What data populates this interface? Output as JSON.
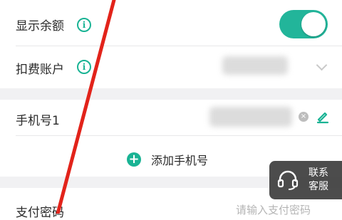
{
  "rows": {
    "show_balance": {
      "label": "显示余额",
      "toggle_on": true
    },
    "deduct_account": {
      "label": "扣费账户"
    },
    "phone": {
      "label": "手机号1"
    },
    "add_phone": {
      "label": "添加手机号"
    },
    "pay_password": {
      "label": "支付密码",
      "placeholder": "请输入支付密码"
    }
  },
  "info_icon_glyph": "i",
  "plus_icon_glyph": "+",
  "customer_service": {
    "line1": "联系",
    "line2": "客服"
  },
  "colors": {
    "accent": "#19b394",
    "toggle": "#22b59a",
    "annotation": "#e2231a",
    "section_gap": "#f1f1f3"
  },
  "icons": {
    "info": "info-circle-icon",
    "toggle": "toggle-switch",
    "dropdown": "chevron-down-icon",
    "clear": "clear-icon",
    "edit": "edit-pencil-icon",
    "add": "plus-circle-icon",
    "headset": "headset-icon"
  }
}
